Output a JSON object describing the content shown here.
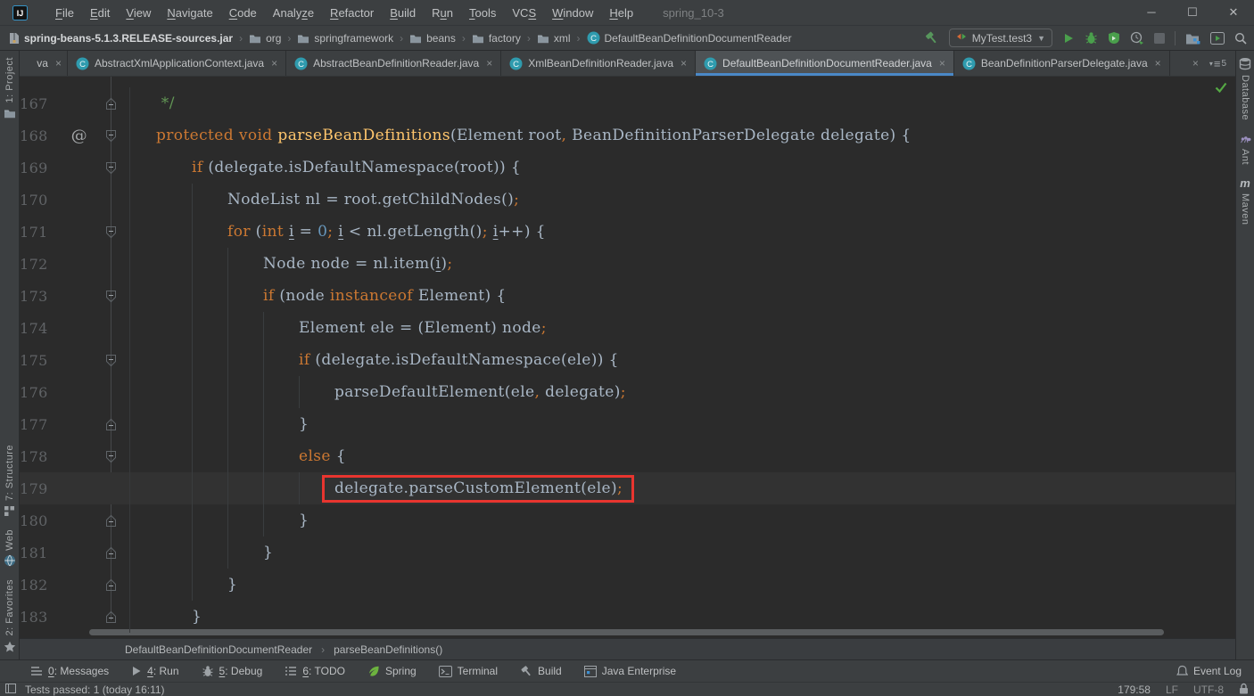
{
  "window": {
    "project": "spring_10-3",
    "controls": {
      "minimize": "─",
      "maximize": "☐",
      "close": "✕"
    }
  },
  "menu": {
    "items": [
      {
        "label": "File",
        "u": 0
      },
      {
        "label": "Edit",
        "u": 0
      },
      {
        "label": "View",
        "u": 0
      },
      {
        "label": "Navigate",
        "u": 0
      },
      {
        "label": "Code",
        "u": 0
      },
      {
        "label": "Analyze",
        "u": 5
      },
      {
        "label": "Refactor",
        "u": 0
      },
      {
        "label": "Build",
        "u": 0
      },
      {
        "label": "Run",
        "u": 1
      },
      {
        "label": "Tools",
        "u": 0
      },
      {
        "label": "VCS",
        "u": 2
      },
      {
        "label": "Window",
        "u": 0
      },
      {
        "label": "Help",
        "u": 0
      }
    ]
  },
  "navbar": {
    "separator": "›",
    "breadcrumbs": [
      {
        "label": "spring-beans-5.1.3.RELEASE-sources.jar",
        "icon": "jar",
        "bold": true
      },
      {
        "label": "org",
        "icon": "folder"
      },
      {
        "label": "springframework",
        "icon": "folder"
      },
      {
        "label": "beans",
        "icon": "folder"
      },
      {
        "label": "factory",
        "icon": "folder"
      },
      {
        "label": "xml",
        "icon": "folder"
      },
      {
        "label": "DefaultBeanDefinitionDocumentReader",
        "icon": "class"
      }
    ],
    "run_config": "MyTest.test3"
  },
  "tabs": {
    "items": [
      {
        "label": "va",
        "icon": false,
        "partial": true
      },
      {
        "label": "AbstractXmlApplicationContext.java",
        "icon": true
      },
      {
        "label": "AbstractBeanDefinitionReader.java",
        "icon": true
      },
      {
        "label": "XmlBeanDefinitionReader.java",
        "icon": true
      },
      {
        "label": "DefaultBeanDefinitionDocumentReader.java",
        "icon": true,
        "active": true
      },
      {
        "label": "BeanDefinitionParserDelegate.java",
        "icon": true
      }
    ],
    "close_glyph": "×",
    "overflow_close": "×",
    "list_count": "5"
  },
  "editor": {
    "red_box_color": "#e8352f",
    "lines": [
      {
        "num": 167,
        "indent": 0,
        "fold": "up",
        "tokens": [
          {
            "t": " */",
            "c": "c"
          }
        ]
      },
      {
        "num": 168,
        "indent": 0,
        "fold": "down",
        "anno": "@",
        "tokens": [
          {
            "t": "protected void ",
            "c": "k"
          },
          {
            "t": "parseBeanDefinitions",
            "c": "m"
          },
          {
            "t": "(Element root",
            "c": "d"
          },
          {
            "t": ",",
            "c": "k"
          },
          {
            "t": " BeanDefinitionParserDelegate delegate) {",
            "c": "d"
          }
        ]
      },
      {
        "num": 169,
        "indent": 1,
        "fold": "down",
        "tokens": [
          {
            "t": "if ",
            "c": "k"
          },
          {
            "t": "(delegate.isDefaultNamespace(root)) {",
            "c": "d"
          }
        ]
      },
      {
        "num": 170,
        "indent": 2,
        "tokens": [
          {
            "t": "NodeList nl = root.getChildNodes()",
            "c": "d"
          },
          {
            "t": ";",
            "c": "k"
          }
        ]
      },
      {
        "num": 171,
        "indent": 2,
        "fold": "down",
        "tokens": [
          {
            "t": "for ",
            "c": "k"
          },
          {
            "t": "(",
            "c": "d"
          },
          {
            "t": "int ",
            "c": "k"
          },
          {
            "t": "i",
            "c": "u"
          },
          {
            "t": " = ",
            "c": "d"
          },
          {
            "t": "0",
            "c": "n"
          },
          {
            "t": ";",
            "c": "k"
          },
          {
            "t": " ",
            "c": "d"
          },
          {
            "t": "i",
            "c": "u"
          },
          {
            "t": " < nl.getLength()",
            "c": "d"
          },
          {
            "t": ";",
            "c": "k"
          },
          {
            "t": " ",
            "c": "d"
          },
          {
            "t": "i",
            "c": "u"
          },
          {
            "t": "++) {",
            "c": "d"
          }
        ]
      },
      {
        "num": 172,
        "indent": 3,
        "tokens": [
          {
            "t": "Node node = nl.item(",
            "c": "d"
          },
          {
            "t": "i",
            "c": "u"
          },
          {
            "t": ")",
            "c": "d"
          },
          {
            "t": ";",
            "c": "k"
          }
        ]
      },
      {
        "num": 173,
        "indent": 3,
        "fold": "down",
        "tokens": [
          {
            "t": "if ",
            "c": "k"
          },
          {
            "t": "(node ",
            "c": "d"
          },
          {
            "t": "instanceof",
            "c": "k"
          },
          {
            "t": " Element) {",
            "c": "d"
          }
        ]
      },
      {
        "num": 174,
        "indent": 4,
        "tokens": [
          {
            "t": "Element ele = (Element) node",
            "c": "d"
          },
          {
            "t": ";",
            "c": "k"
          }
        ]
      },
      {
        "num": 175,
        "indent": 4,
        "fold": "down",
        "tokens": [
          {
            "t": "if ",
            "c": "k"
          },
          {
            "t": "(delegate.isDefaultNamespace(ele)) {",
            "c": "d"
          }
        ]
      },
      {
        "num": 176,
        "indent": 5,
        "tokens": [
          {
            "t": "parseDefaultElement(ele",
            "c": "d"
          },
          {
            "t": ",",
            "c": "k"
          },
          {
            "t": " delegate)",
            "c": "d"
          },
          {
            "t": ";",
            "c": "k"
          }
        ]
      },
      {
        "num": 177,
        "indent": 4,
        "fold": "up",
        "tokens": [
          {
            "t": "}",
            "c": "d"
          }
        ]
      },
      {
        "num": 178,
        "indent": 4,
        "fold": "down",
        "tokens": [
          {
            "t": "else",
            "c": "k"
          },
          {
            "t": " {",
            "c": "d"
          }
        ]
      },
      {
        "num": 179,
        "indent": 5,
        "current": true,
        "box": true,
        "tokens": [
          {
            "t": "delegate.parseCustomElement(ele)",
            "c": "d"
          },
          {
            "t": ";",
            "c": "k"
          }
        ]
      },
      {
        "num": 180,
        "indent": 4,
        "fold": "up",
        "tokens": [
          {
            "t": "}",
            "c": "d"
          }
        ]
      },
      {
        "num": 181,
        "indent": 3,
        "fold": "up",
        "tokens": [
          {
            "t": "}",
            "c": "d"
          }
        ]
      },
      {
        "num": 182,
        "indent": 2,
        "fold": "up",
        "tokens": [
          {
            "t": "}",
            "c": "d"
          }
        ]
      },
      {
        "num": 183,
        "indent": 1,
        "fold": "up",
        "tokens": [
          {
            "t": "}",
            "c": "d"
          }
        ]
      }
    ]
  },
  "breadcrumb_bottom": {
    "class": "DefaultBeanDefinitionDocumentReader",
    "method": "parseBeanDefinitions()",
    "separator": "›"
  },
  "stripes": {
    "left_top": [
      {
        "label": "1: Project",
        "u": 0,
        "icon": "folder"
      }
    ],
    "left_bottom": [
      {
        "label": "7: Structure",
        "u": 0,
        "icon": "structure"
      },
      {
        "label": "Web",
        "icon": "web"
      },
      {
        "label": "2: Favorites",
        "u": 0,
        "icon": "star"
      }
    ],
    "right": [
      {
        "label": "Database",
        "icon": "database"
      },
      {
        "label": "Ant",
        "icon": "ant"
      },
      {
        "label": "Maven",
        "icon": "maven"
      }
    ]
  },
  "toolwindow_bar": {
    "items": [
      {
        "label": "0: Messages",
        "u": 0,
        "icon": "messages"
      },
      {
        "label": "4: Run",
        "u": 0,
        "icon": "run-gray"
      },
      {
        "label": "5: Debug",
        "u": 0,
        "icon": "debug-gray"
      },
      {
        "label": "6: TODO",
        "u": 0,
        "icon": "todo"
      },
      {
        "label": "Spring",
        "icon": "spring"
      },
      {
        "label": "Terminal",
        "icon": "terminal"
      },
      {
        "label": "Build",
        "icon": "build"
      },
      {
        "label": "Java Enterprise",
        "icon": "javaee"
      }
    ],
    "event_log": "Event Log"
  },
  "statusbar": {
    "message": "Tests passed: 1 (today 16:11)",
    "caret": "179:58",
    "line_ending": "LF",
    "encoding": "UTF-8"
  }
}
